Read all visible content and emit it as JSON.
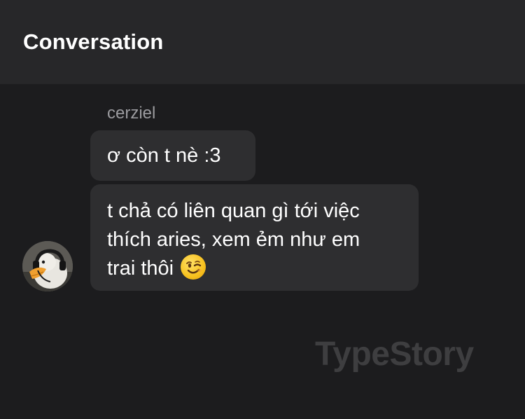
{
  "header": {
    "title": "Conversation"
  },
  "message_group": {
    "sender": "cerziel",
    "messages": [
      {
        "text": "ơ còn t nè :3"
      },
      {
        "lines": [
          "t chả có liên quan gì tới việc",
          "thích aries, xem ẻm như em",
          "trai thôi"
        ],
        "emoji": "winking-face-emoji"
      }
    ]
  },
  "watermark": "TypeStory",
  "colors": {
    "background": "#1c1c1e",
    "header": "#272729",
    "bubble": "#2e2e30",
    "sender": "#9b9b9f",
    "watermark": "#3e3e40"
  }
}
